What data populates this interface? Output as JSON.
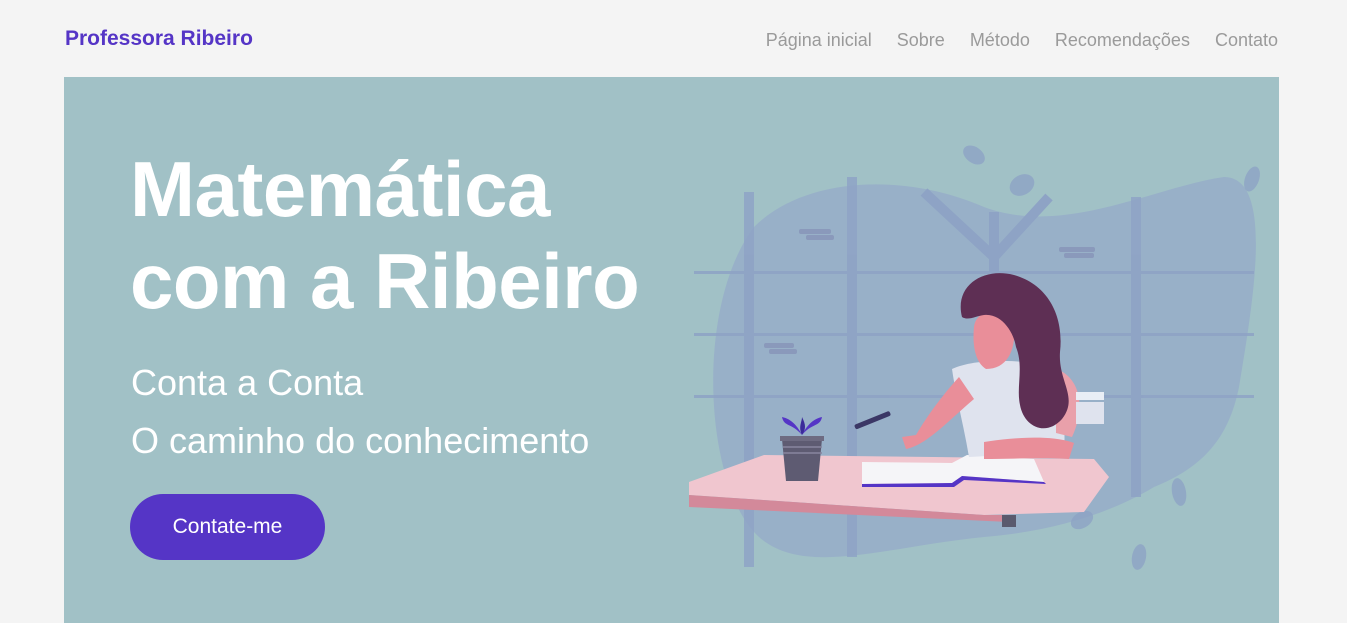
{
  "brand": "Professora Ribeiro",
  "nav": {
    "items": [
      "Página inicial",
      "Sobre",
      "Método",
      "Recomendações",
      "Contato"
    ]
  },
  "hero": {
    "title_line1": "Matemática",
    "title_line2": "com a Ribeiro",
    "subtitle_line1": "Conta a Conta",
    "subtitle_line2": "O caminho do conhecimento",
    "cta_label": "Contate-me"
  },
  "colors": {
    "accent": "#5535c6",
    "hero_background": "#a1c1c6",
    "page_background": "#f4f4f4",
    "nav_text": "#9a9a9a"
  },
  "illustration": "woman-studying-at-desk-illustration"
}
